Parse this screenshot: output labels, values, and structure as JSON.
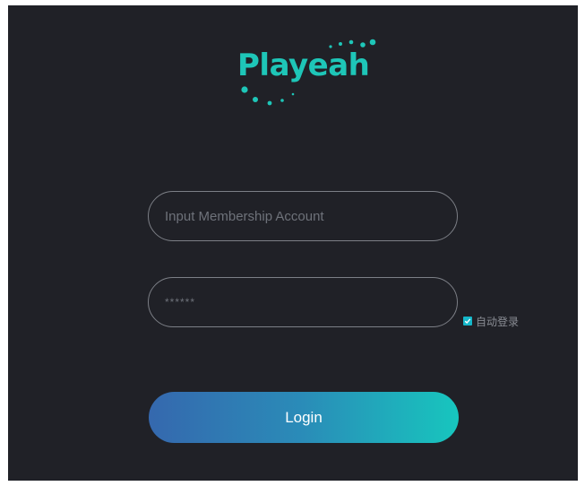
{
  "logo": {
    "text": "Playeah",
    "color": "#1ec6b8"
  },
  "form": {
    "account_placeholder": "Input Membership Account",
    "password_value": "******",
    "auto_login_label": "自动登录",
    "auto_login_checked": true,
    "login_label": "Login"
  },
  "colors": {
    "background": "#202127",
    "accent": "#15b7c9",
    "button_gradient_start": "#3568ae",
    "button_gradient_end": "#17c6be"
  },
  "icons": {
    "checkbox": "checkmark-icon"
  }
}
